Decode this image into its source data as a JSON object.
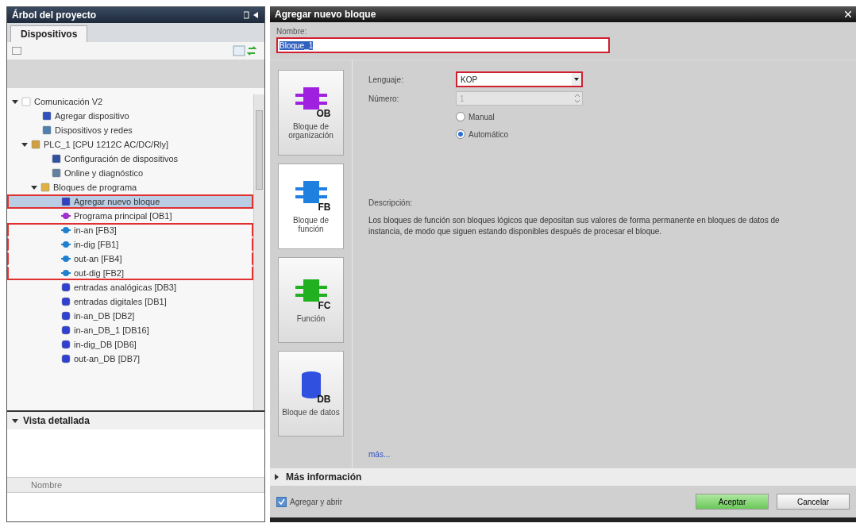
{
  "project_tree": {
    "title": "Árbol del proyecto",
    "tab": {
      "label": "Dispositivos",
      "selected": true
    },
    "items": [
      {
        "label": "Comunicación V2",
        "kind": "project",
        "expanded": true,
        "selected": false,
        "highlighted": false,
        "children": [
          {
            "label": "Agregar dispositivo",
            "kind": "add-device",
            "selected": false,
            "highlighted": false
          },
          {
            "label": "Dispositivos y redes",
            "kind": "network",
            "selected": false,
            "highlighted": false
          },
          {
            "label": "PLC_1 [CPU 1212C AC/DC/Rly]",
            "kind": "plc",
            "expanded": true,
            "selected": false,
            "highlighted": false,
            "children": [
              {
                "label": "Configuración de dispositivos",
                "kind": "config",
                "selected": false,
                "highlighted": false
              },
              {
                "label": "Online y diagnóstico",
                "kind": "online",
                "selected": false,
                "highlighted": false
              },
              {
                "label": "Bloques de programa",
                "kind": "folder",
                "expanded": true,
                "selected": false,
                "highlighted": false,
                "children": [
                  {
                    "label": "Agregar nuevo bloque",
                    "kind": "add-block",
                    "selected": true,
                    "highlighted": true
                  },
                  {
                    "label": "Programa principal [OB1]",
                    "kind": "ob",
                    "selected": false,
                    "highlighted": false
                  },
                  {
                    "label": "in-an [FB3]",
                    "kind": "fb",
                    "selected": false,
                    "highlighted": true
                  },
                  {
                    "label": "in-dig [FB1]",
                    "kind": "fb",
                    "selected": false,
                    "highlighted": true
                  },
                  {
                    "label": "out-an [FB4]",
                    "kind": "fb",
                    "selected": false,
                    "highlighted": true
                  },
                  {
                    "label": "out-dig [FB2]",
                    "kind": "fb",
                    "selected": false,
                    "highlighted": true
                  },
                  {
                    "label": "entradas analógicas [DB3]",
                    "kind": "db",
                    "selected": false,
                    "highlighted": false
                  },
                  {
                    "label": "entradas digitales [DB1]",
                    "kind": "db",
                    "selected": false,
                    "highlighted": false
                  },
                  {
                    "label": "in-an_DB [DB2]",
                    "kind": "db",
                    "selected": false,
                    "highlighted": false
                  },
                  {
                    "label": "in-an_DB_1 [DB16]",
                    "kind": "db",
                    "selected": false,
                    "highlighted": false
                  },
                  {
                    "label": "in-dig_DB [DB6]",
                    "kind": "db",
                    "selected": false,
                    "highlighted": false
                  },
                  {
                    "label": "out-an_DB [DB7]",
                    "kind": "db",
                    "selected": false,
                    "highlighted": false
                  }
                ]
              }
            ]
          }
        ]
      }
    ]
  },
  "detail_view": {
    "title": "Vista detallada",
    "expanded": true,
    "column": "Nombre"
  },
  "dialog": {
    "title": "Agregar nuevo bloque",
    "name_label": "Nombre:",
    "name_value": "Bloque_1",
    "block_types": [
      {
        "code": "OB",
        "label": "Bloque de organización",
        "selected": false,
        "color": "#a020e0"
      },
      {
        "code": "FB",
        "label": "Bloque de función",
        "selected": true,
        "color": "#2080e0"
      },
      {
        "code": "FC",
        "label": "Función",
        "selected": false,
        "color": "#20b020"
      },
      {
        "code": "DB",
        "label": "Bloque de datos",
        "selected": false,
        "color": "#3050e0"
      }
    ],
    "language_label": "Lenguaje:",
    "language": "KOP",
    "number_label": "Número:",
    "number": "1",
    "number_modes": [
      {
        "label": "Manual",
        "selected": false
      },
      {
        "label": "Automático",
        "selected": true
      }
    ],
    "description_label": "Descripción:",
    "description": "Los bloques de función son bloques lógicos que depositan sus valores de forma permanente en bloques de datos de instancia, de modo que siguen estando disponibles después de procesar el bloque.",
    "more_link": "más...",
    "more_info": {
      "label": "Más información",
      "expanded": false
    },
    "add_and_open": {
      "label": "Agregar y abrir",
      "checked": true
    },
    "buttons": [
      {
        "label": "Aceptar",
        "kind": "primary"
      },
      {
        "label": "Cancelar",
        "kind": "secondary"
      }
    ]
  }
}
